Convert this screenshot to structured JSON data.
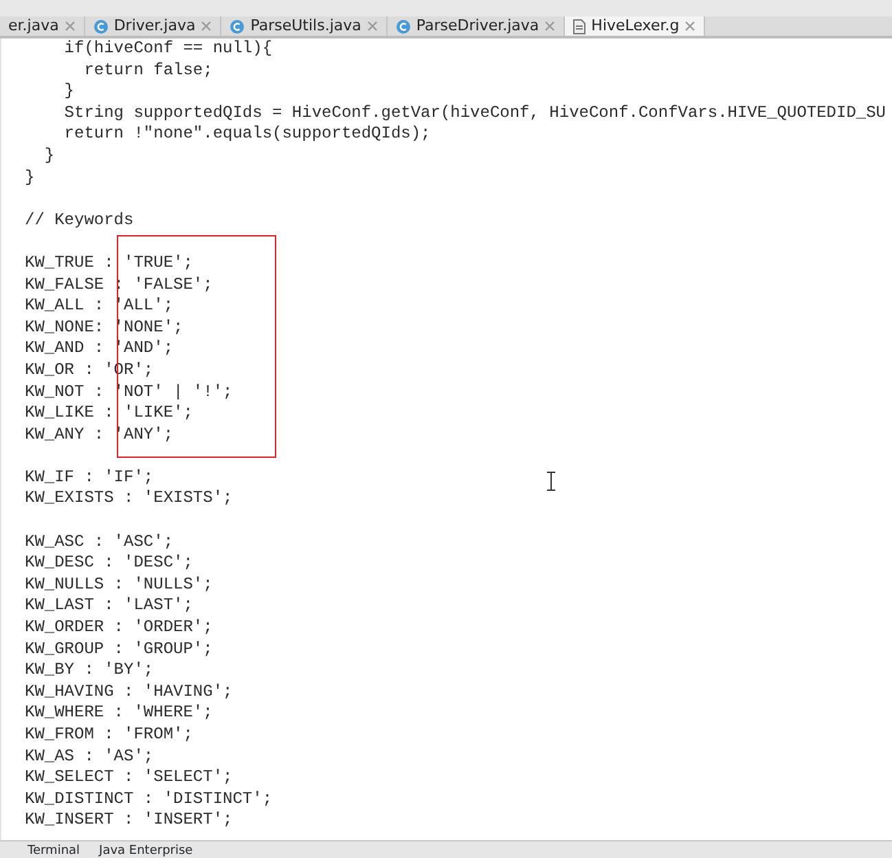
{
  "tabs": [
    {
      "label": "er.java",
      "kind": "none",
      "selected": false
    },
    {
      "label": "Driver.java",
      "kind": "class",
      "selected": false
    },
    {
      "label": "ParseUtils.java",
      "kind": "class",
      "selected": false
    },
    {
      "label": "ParseDriver.java",
      "kind": "class",
      "selected": false
    },
    {
      "label": "HiveLexer.g",
      "kind": "file",
      "selected": true
    }
  ],
  "code_blocks": [
    [
      "    if(hiveConf == null){",
      "      return false;",
      "    }",
      "    String supportedQIds = HiveConf.getVar(hiveConf, HiveConf.ConfVars.HIVE_QUOTEDID_SU",
      "    return !\"none\".equals(supportedQIds);",
      "  }",
      "}"
    ],
    [
      "// Keywords"
    ],
    [
      "KW_TRUE : 'TRUE';",
      "KW_FALSE : 'FALSE';",
      "KW_ALL : 'ALL';",
      "KW_NONE: 'NONE';",
      "KW_AND : 'AND';",
      "KW_OR : 'OR';",
      "KW_NOT : 'NOT' | '!';",
      "KW_LIKE : 'LIKE';",
      "KW_ANY : 'ANY';"
    ],
    [
      "KW_IF : 'IF';",
      "KW_EXISTS : 'EXISTS';"
    ],
    [
      "KW_ASC : 'ASC';",
      "KW_DESC : 'DESC';",
      "KW_NULLS : 'NULLS';",
      "KW_LAST : 'LAST';",
      "KW_ORDER : 'ORDER';",
      "KW_GROUP : 'GROUP';",
      "KW_BY : 'BY';",
      "KW_HAVING : 'HAVING';",
      "KW_WHERE : 'WHERE';",
      "KW_FROM : 'FROM';",
      "KW_AS : 'AS';",
      "KW_SELECT : 'SELECT';",
      "KW_DISTINCT : 'DISTINCT';",
      "KW_INSERT : 'INSERT';"
    ]
  ],
  "tool_windows": [
    "Terminal",
    "Java Enterprise"
  ]
}
